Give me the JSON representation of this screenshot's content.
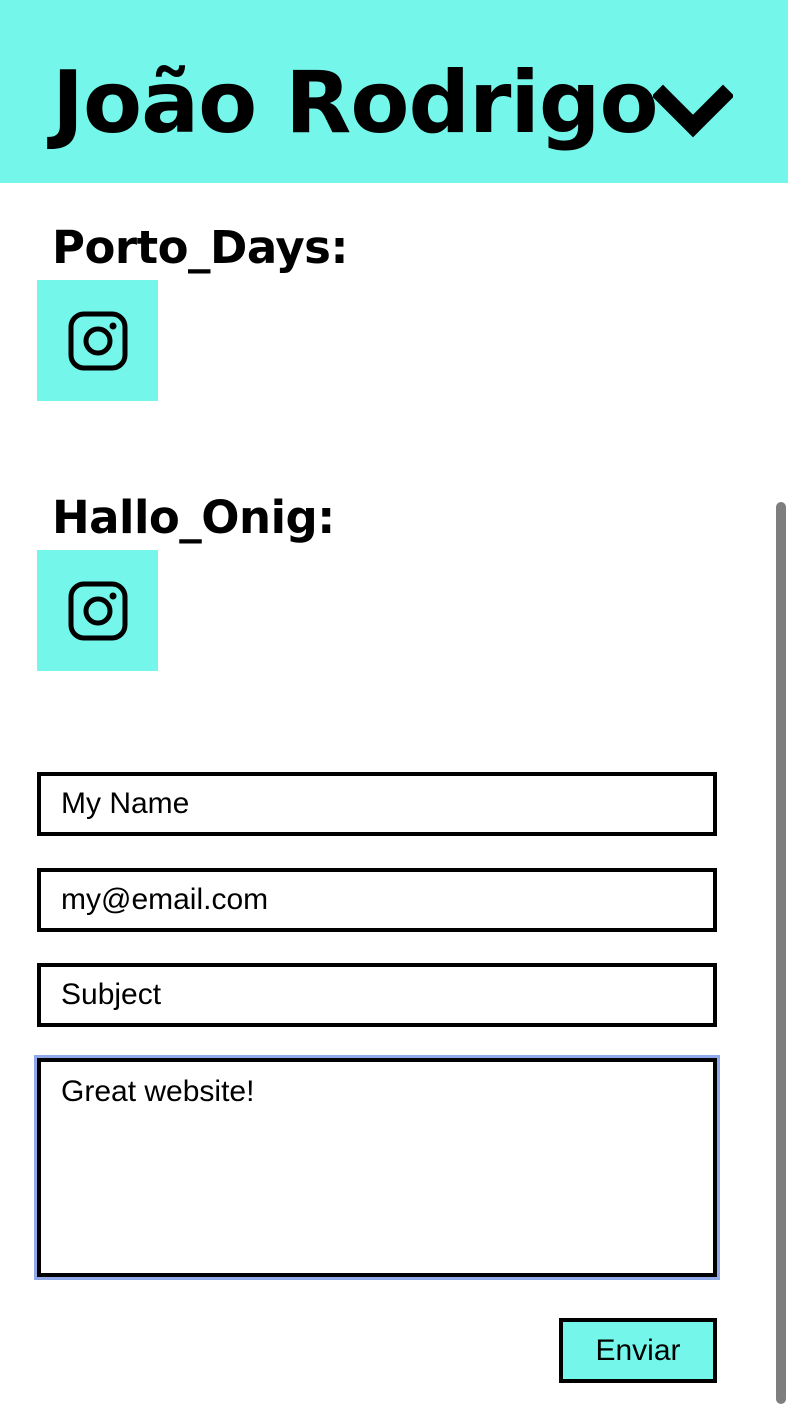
{
  "header": {
    "title": "João Rodrigo",
    "menu_icon": "chevron-down-icon",
    "background": "#74f7ea"
  },
  "sections": [
    {
      "title": "Porto_Days:",
      "icon": "instagram-icon"
    },
    {
      "title": "Hallo_Onig:",
      "icon": "instagram-icon"
    }
  ],
  "form": {
    "name_value": "My Name",
    "email_value": "my@email.com",
    "subject_value": "Subject",
    "message_value": "Great website!",
    "submit_label": "Enviar"
  },
  "colors": {
    "accent": "#74f7ea",
    "focus_ring": "#8fa9ea",
    "scrollbar": "#7e7e7e"
  }
}
